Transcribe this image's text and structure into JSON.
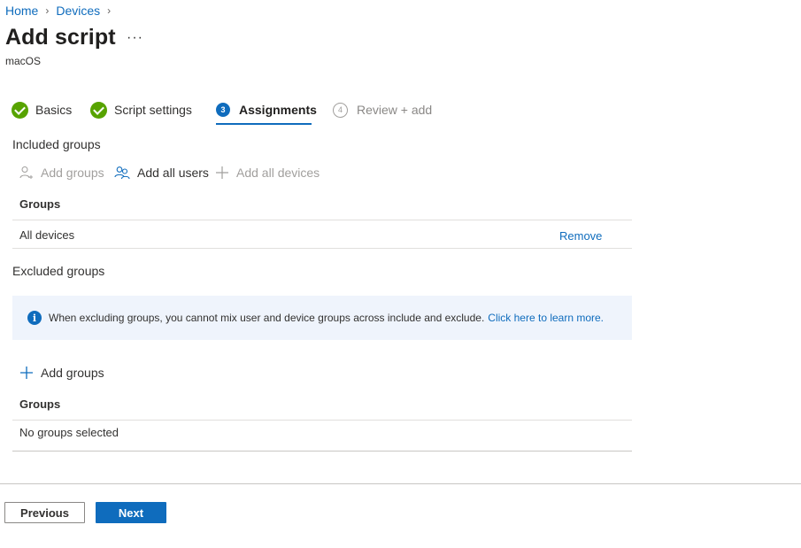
{
  "breadcrumb": {
    "items": [
      "Home",
      "Devices"
    ]
  },
  "header": {
    "title": "Add script",
    "more": "···",
    "subtitle": "macOS"
  },
  "wizard": {
    "steps": [
      {
        "label": "Basics",
        "state": "completed"
      },
      {
        "label": "Script settings",
        "state": "completed"
      },
      {
        "label": "Assignments",
        "number": "3",
        "state": "active"
      },
      {
        "label": "Review + add",
        "number": "4",
        "state": "pending"
      }
    ]
  },
  "included": {
    "heading": "Included groups",
    "commands": {
      "add_groups": "Add groups",
      "add_all_users": "Add all users",
      "add_all_devices": "Add all devices"
    },
    "column_header": "Groups",
    "rows": [
      {
        "name": "All devices",
        "action": "Remove"
      }
    ]
  },
  "excluded": {
    "heading": "Excluded groups",
    "info_text": "When excluding groups, you cannot mix user and device groups across include and exclude.",
    "info_link": "Click here to learn more.",
    "add_groups": "Add groups",
    "column_header": "Groups",
    "empty_text": "No groups selected"
  },
  "footer": {
    "previous": "Previous",
    "next": "Next"
  },
  "colors": {
    "accent": "#0f6cbd",
    "success": "#57a300",
    "info_bg": "#eff4fc"
  }
}
